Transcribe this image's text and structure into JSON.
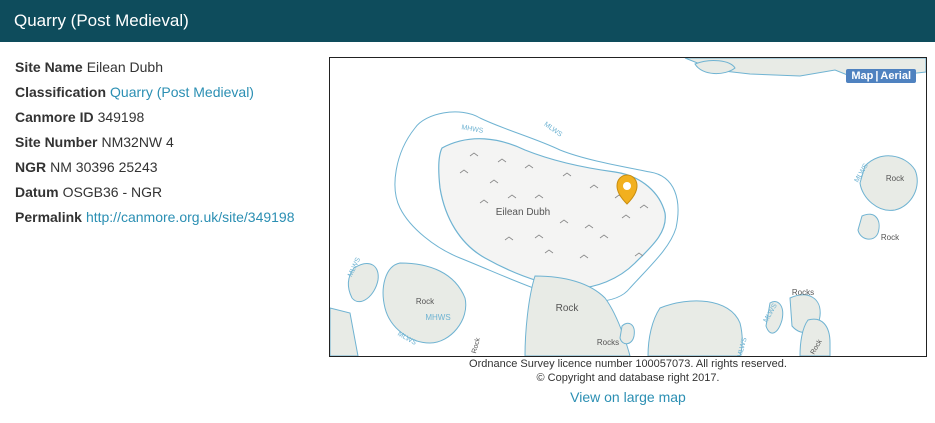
{
  "header": {
    "title": "Quarry (Post Medieval)"
  },
  "details": [
    {
      "label": "Site Name",
      "value": "Eilean Dubh",
      "link": false
    },
    {
      "label": "Classification",
      "value": "Quarry (Post Medieval)",
      "link": true
    },
    {
      "label": "Canmore ID",
      "value": "349198",
      "link": false
    },
    {
      "label": "Site Number",
      "value": "NM32NW 4",
      "link": false
    },
    {
      "label": "NGR",
      "value": "NM 30396 25243",
      "link": false
    },
    {
      "label": "Datum",
      "value": "OSGB36 - NGR",
      "link": false
    },
    {
      "label": "Permalink",
      "value": "http://canmore.org.uk/site/349198",
      "link": true
    }
  ],
  "map": {
    "toggle_map": "Map",
    "toggle_sep": "|",
    "toggle_aerial": "Aerial",
    "island_name": "Eilean Dubh",
    "labels": {
      "mhws": "MHWS",
      "mlws": "MLWS",
      "rock": "Rock",
      "rocks": "Rocks"
    },
    "colors": {
      "water_line": "#6fb3d2",
      "land": "#e8ebe6",
      "marker": "#f2b01e"
    }
  },
  "licence": {
    "line1": "Ordnance Survey licence number 100057073. All rights reserved.",
    "line2": "© Copyright and database right 2017."
  },
  "large_map_link": "View on large map"
}
